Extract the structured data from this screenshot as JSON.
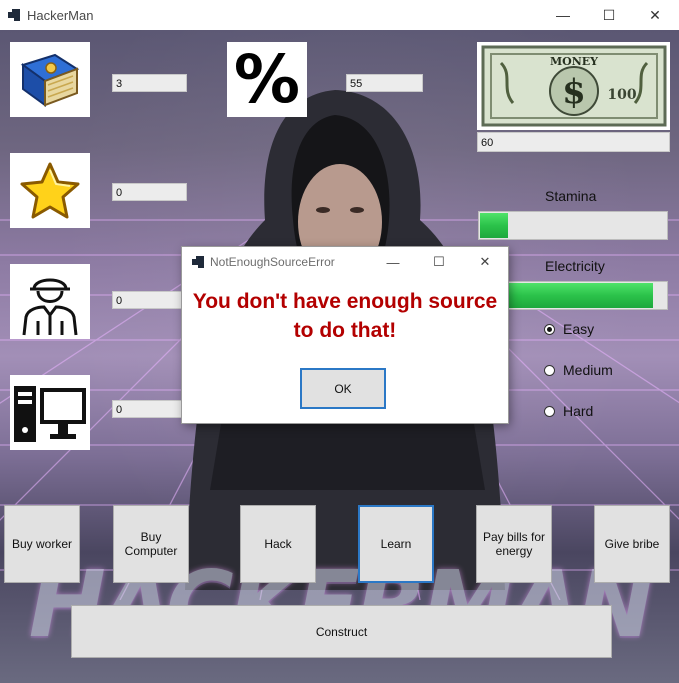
{
  "window": {
    "title": "HackerMan",
    "minimize_glyph": "—",
    "maximize_glyph": "☐",
    "close_glyph": "✕"
  },
  "resources": {
    "books": "3",
    "stars": "0",
    "workers": "0",
    "computers": "0",
    "percent": "55",
    "money": "60"
  },
  "icons": {
    "books": "book-icon",
    "stars": "star-icon",
    "workers": "worker-icon",
    "computers": "computer-icon",
    "percent": "percent-icon",
    "money": "dollar-bill-icon"
  },
  "percent_symbol": "%",
  "bill": {
    "top_text": "MONEY",
    "center_text": "$",
    "corner_text": "100"
  },
  "stamina": {
    "label": "Stamina",
    "level": 0.15
  },
  "electricity": {
    "label": "Electricity",
    "level": 0.93
  },
  "difficulty": {
    "options": [
      "Easy",
      "Medium",
      "Hard"
    ],
    "selected": "Easy"
  },
  "actions": {
    "buy_worker": "Buy worker",
    "buy_computer": "Buy Computer",
    "hack": "Hack",
    "learn": "Learn",
    "pay_bills": "Pay bills for energy",
    "give_bribe": "Give bribe",
    "construct": "Construct"
  },
  "background_wordmark": "HACKERMAN",
  "dialog": {
    "title": "NotEnoughSourceError",
    "message": "You don't have enough source to do that!",
    "ok": "OK"
  },
  "colors": {
    "error_text": "#b30000",
    "focus_border": "#2b78c6",
    "bar_green": "#2bc24a"
  }
}
